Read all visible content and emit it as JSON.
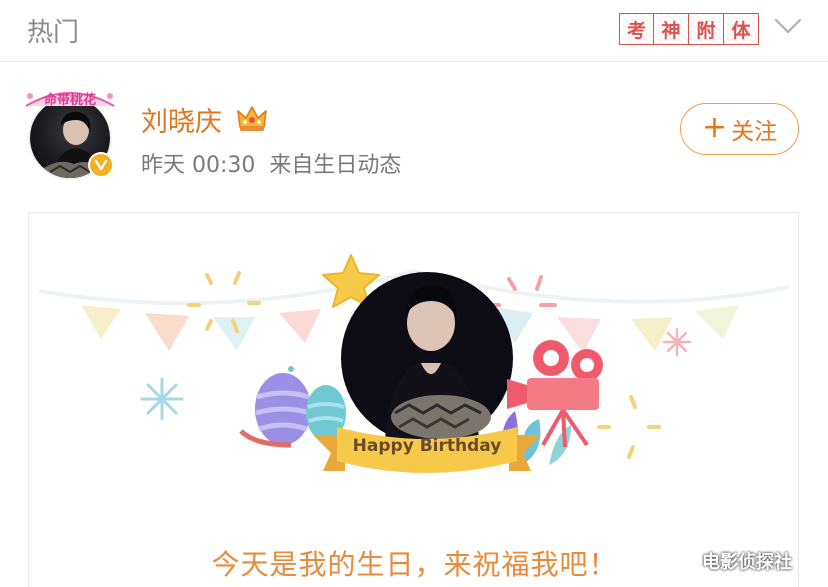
{
  "header": {
    "tab_title": "热门",
    "stamp_chars": [
      "考",
      "神",
      "附",
      "体"
    ],
    "expand_icon": "chevron-down-icon"
  },
  "post": {
    "avatar_frame_text": "命带桃花",
    "author_name": "刘晓庆",
    "badge_icon": "crown-icon",
    "verified_icon": "verified-v-icon",
    "time": "昨天 00:30",
    "source": "来自生日动态",
    "follow_label": "关注",
    "follow_icon": "plus-icon"
  },
  "card": {
    "banner_text": "Happy Birthday",
    "message": "今天是我的生日，来祝福我吧！",
    "colors": {
      "accent": "#e2761e",
      "banner": "#f7c94a",
      "star": "#f7c948"
    }
  },
  "watermark": "电影侦探社"
}
